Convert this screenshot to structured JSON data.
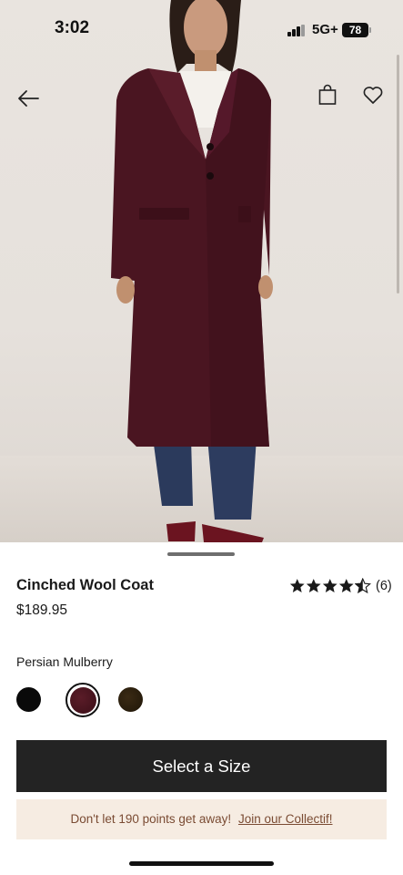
{
  "status_bar": {
    "time": "3:02",
    "network": "5G+",
    "battery": "78"
  },
  "hero": {
    "image_subject": "model wearing long burgundy wool coat",
    "icons": {
      "back": "arrow-left-icon",
      "bag": "shopping-bag-icon",
      "wishlist": "heart-icon"
    }
  },
  "product": {
    "name": "Cinched Wool Coat",
    "price": "$189.95",
    "rating_value": 4.5,
    "rating_max": 5,
    "review_count": "(6)",
    "color_label": "Persian Mulberry",
    "swatches": [
      {
        "name": "Black",
        "color": "#0a0a0a",
        "selected": false
      },
      {
        "name": "Persian Mulberry",
        "color": "#4a1521",
        "selected": true
      },
      {
        "name": "Brown",
        "color": "#2a1f0e",
        "selected": false
      }
    ]
  },
  "actions": {
    "select_size_label": "Select a Size"
  },
  "promo": {
    "text": "Don't let 190 points get away!",
    "link_text": "Join our Collectif!"
  },
  "colors": {
    "button_bg": "#232323",
    "promo_bg": "#f6ece2",
    "promo_text": "#7a4b33",
    "coat": "#4a1521"
  }
}
